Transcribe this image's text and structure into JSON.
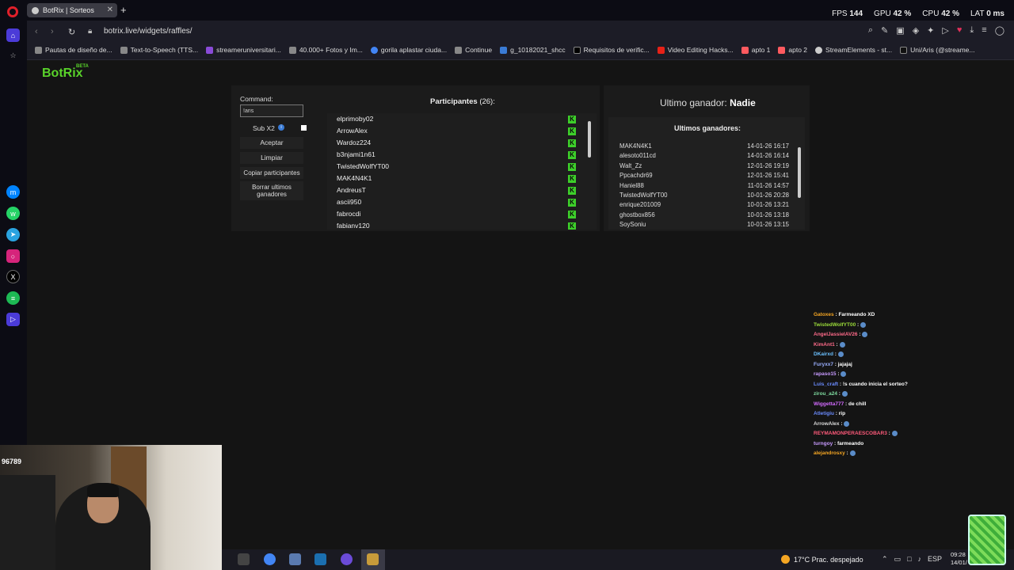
{
  "browser": {
    "tab_title": "BotRix | Sorteos",
    "tab_close": "✕",
    "new_tab": "+",
    "perf": {
      "fps_label": "FPS",
      "fps": "144",
      "gpu_label": "GPU",
      "gpu": "42 %",
      "cpu_label": "CPU",
      "cpu": "42 %",
      "lat_label": "LAT",
      "lat": "0 ms"
    },
    "url": "botrix.live/widgets/raffles/",
    "bookmarks": [
      "Pautas de diseño de...",
      "Text-to-Speech (TTS...",
      "streameruniversitari...",
      "40.000+ Fotos y Im...",
      "gorila aplastar ciuda...",
      "Continue",
      "g_10182021_shcc",
      "Requisitos de verific...",
      "Video Editing Hacks...",
      "apto 1",
      "apto 2",
      "StreamElements - st...",
      "Uni/Aris (@streame..."
    ]
  },
  "app": {
    "logo": "BotRix",
    "beta": "BETA",
    "command_label": "Command:",
    "command_value": "!aris",
    "sub_label": "Sub X2",
    "buttons": {
      "accept": "Aceptar",
      "clear": "Limpiar",
      "copy": "Copiar participantes",
      "delete_line1": "Borrar ultimos",
      "delete_line2": "ganadores"
    },
    "participants_title": "Participantes",
    "participants_count": "(26):",
    "participants": [
      "elprimoby02",
      "ArrowAlex",
      "Wardoz224",
      "b3njami1n61",
      "TwistedWolfYT00",
      "MAK4N4K1",
      "AndreusT",
      "ascii950",
      "fabrocdi",
      "fabianv120"
    ],
    "last_winner_label": "Ultimo ganador:",
    "last_winner": "Nadie",
    "winners_title": "Ultimos ganadores:",
    "winners": [
      {
        "name": "MAK4N4K1",
        "date": "14-01-26 16:17"
      },
      {
        "name": "alesoto011cd",
        "date": "14-01-26 16:14"
      },
      {
        "name": "Walt_Zz",
        "date": "12-01-26 19:19"
      },
      {
        "name": "Ppcachdr69",
        "date": "12-01-26 15:41"
      },
      {
        "name": "Haniel88",
        "date": "11-01-26 14:57"
      },
      {
        "name": "TwistedWolfYT00",
        "date": "10-01-26 20:28"
      },
      {
        "name": "enrique201009",
        "date": "10-01-26 13:21"
      },
      {
        "name": "ghostbox856",
        "date": "10-01-26 13:18"
      },
      {
        "name": "SoySoniu",
        "date": "10-01-26 13:15"
      }
    ]
  },
  "chat": [
    {
      "user": "Gatoxes",
      "msg": "Farmeando XD",
      "color": "#f5a623"
    },
    {
      "user": "TwistedWolfYT00",
      "msg": "",
      "color": "#9bdc3a"
    },
    {
      "user": "AngelJassielAV26",
      "msg": "",
      "color": "#ff6b8a"
    },
    {
      "user": "KimAnt1",
      "msg": "",
      "color": "#ff6b8a"
    },
    {
      "user": "DKairxd",
      "msg": "",
      "color": "#6bc0ff"
    },
    {
      "user": "Furyxx7",
      "msg": "jajajaj",
      "color": "#9bb0ff"
    },
    {
      "user": "rapaso15",
      "msg": "",
      "color": "#c89bff"
    },
    {
      "user": "Luis_craft",
      "msg": "!s cuando inicia el sorteo?",
      "color": "#6b8cff"
    },
    {
      "user": "zirou_a24",
      "msg": "",
      "color": "#7fdca0"
    },
    {
      "user": "Wiggetta777",
      "msg": "de chill",
      "color": "#d36bff"
    },
    {
      "user": "Atletigiu",
      "msg": "rip",
      "color": "#6b8cff"
    },
    {
      "user": "ArrowAlex",
      "msg": "",
      "color": "#dddddd"
    },
    {
      "user": "REYMAMONPERAESCOBAR3",
      "msg": "",
      "color": "#ff5a7a"
    },
    {
      "user": "turngoy",
      "msg": "farmeando",
      "color": "#c89bff"
    },
    {
      "user": "alejandrosxy",
      "msg": "",
      "color": "#f5a623"
    }
  ],
  "webcam": {
    "counter": "96789"
  },
  "taskbar": {
    "weather": "17°C  Prac. despejado",
    "lang": "ESP",
    "time": "09:28",
    "date": "14/01/"
  }
}
